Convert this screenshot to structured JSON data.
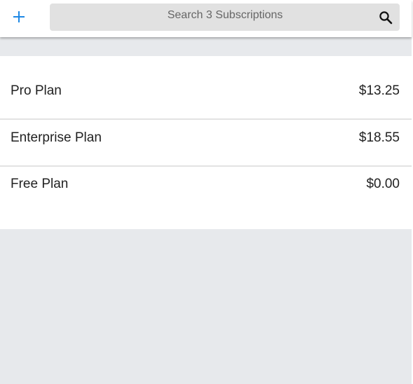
{
  "header": {
    "add_icon": "plus-icon",
    "search": {
      "placeholder": "Search 3 Subscriptions",
      "value": "",
      "icon": "search-icon"
    }
  },
  "subscriptions": [
    {
      "name": "Pro Plan",
      "price": "$13.25"
    },
    {
      "name": "Enterprise Plan",
      "price": "$18.55"
    },
    {
      "name": "Free Plan",
      "price": "$0.00"
    }
  ],
  "colors": {
    "accent": "#1e88e5",
    "background": "#e7e9ec",
    "search_bg": "#e1e1e1",
    "text": "#222222"
  }
}
